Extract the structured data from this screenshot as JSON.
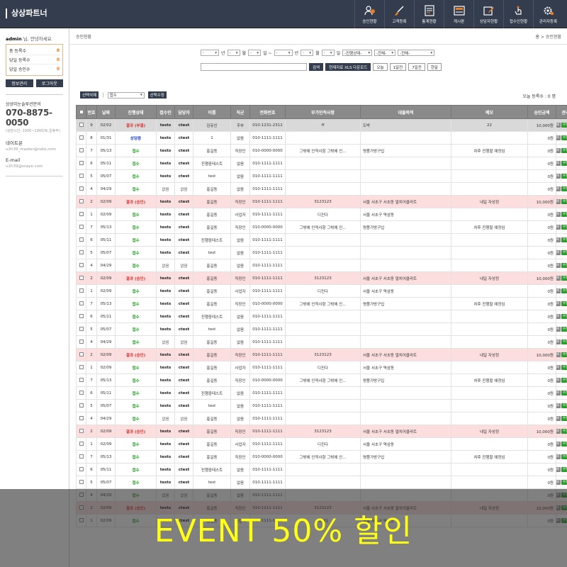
{
  "app": {
    "brand": "상상파트너"
  },
  "nav": [
    {
      "label": "승인현황",
      "icon": "users-icon"
    },
    {
      "label": "고객등록",
      "icon": "brush-icon"
    },
    {
      "label": "통계현황",
      "icon": "chart-board-icon"
    },
    {
      "label": "게시판",
      "icon": "board-icon"
    },
    {
      "label": "상담자현황",
      "icon": "edit-icon"
    },
    {
      "label": "접수인현황",
      "icon": "hand-click-icon"
    },
    {
      "label": "관리자등록",
      "icon": "gear-icon"
    }
  ],
  "sidebar": {
    "user": "admin",
    "greeting_suffix": " 님, 안녕하세요",
    "stats": [
      {
        "label": "총 등록수",
        "value": "8"
      },
      {
        "label": "당일 등록수",
        "value": "0"
      },
      {
        "label": "당일 승인수",
        "value": "0"
      }
    ],
    "btn_info": "정보관리",
    "btn_logout": "로그아웃",
    "cs_title": "상상미눈솔루션문의",
    "cs_phone": "070-8875-0050",
    "cs_hours": "(상담시간: 1000~1900/토,일휴무)",
    "nateon_label": "네이트온",
    "nateon_value": "u2h39_master@nate.com",
    "email_label": "E-mail",
    "email_value": "u2h39@ssaye.com"
  },
  "main": {
    "page_title": "승인현황",
    "breadcrumb": "홈 > 승인현황",
    "filters": {
      "sep_year": "년",
      "sep_month": "월",
      "sep_day": "일 ~",
      "sep_year2": "년",
      "sep_month2": "월",
      "sep_day2": "일",
      "sel_status": "-진행상태-",
      "sel_all1": "-전체-",
      "sel_all2": "-전체-"
    },
    "search_btn": "검색",
    "xls_btn": "현재자료 XLS 다운로드",
    "quick": [
      "오늘",
      "1일전",
      "7일전",
      "한달"
    ],
    "action_delete": "선택삭제",
    "action_select": "접수",
    "action_modify": "선택수정",
    "today_count": "오늘 등록수 : 0 명",
    "columns": [
      "번호",
      "날짜",
      "진행상태",
      "접수인",
      "담당자",
      "이름",
      "직군",
      "전화번호",
      "부가인적사항",
      "대출목적",
      "메모",
      "승인금액",
      "관리"
    ],
    "manage_labels": [
      "인쇄",
      "수정",
      "삭제"
    ],
    "rows": [
      [
        "9",
        "02/02",
        "결과 (부결)",
        "tests",
        "ctest",
        "김유신",
        "주부",
        "010-1231-2312",
        "ff",
        "도박",
        "22",
        "10,000원"
      ],
      [
        "8",
        "01/31",
        "상담중",
        "tests",
        "ctest",
        "1",
        "없음",
        "010-1111-1111",
        "",
        "",
        "",
        "0원"
      ],
      [
        "7",
        "05/13",
        "접수",
        "tests",
        "ctest",
        "홍길동",
        "직장인",
        "010-0000-0000",
        "그밖에 인적사항 그밖에 인...",
        "명품가방구입",
        "차후 진행할 예정임",
        "0원"
      ],
      [
        "6",
        "05/11",
        "접수",
        "tests",
        "ctest",
        "진행중테스트",
        "없음",
        "010-1111-1111",
        "",
        "",
        "",
        "0원"
      ],
      [
        "5",
        "05/07",
        "접수",
        "tests",
        "ctest",
        "test",
        "없음",
        "010-1111-1111",
        "",
        "",
        "",
        "0원"
      ],
      [
        "4",
        "04/29",
        "접수",
        "없음",
        "없음",
        "홍길동",
        "없음",
        "010-1111-1111",
        "",
        "",
        "",
        "0원"
      ],
      [
        "2",
        "02/09",
        "결과 (승인)",
        "tests",
        "ctest",
        "홍길동",
        "직장인",
        "010-1111-1111",
        "3123123",
        "서울 서초구 서초동 멀치어클라트",
        "내일 자성정",
        "10,000원"
      ],
      [
        "1",
        "02/09",
        "접수",
        "tests",
        "ctest",
        "홍길동",
        "사업자",
        "010-1111-1111",
        "디진다",
        "서울 서초구 역삼동",
        "",
        "0원"
      ],
      [
        "7",
        "05/13",
        "접수",
        "tests",
        "ctest",
        "홍길동",
        "직장인",
        "010-0000-0000",
        "그밖에 인적사항 그밖에 인...",
        "명품가방구입",
        "차후 진행할 예정임",
        "0원"
      ],
      [
        "6",
        "05/11",
        "접수",
        "tests",
        "ctest",
        "진행중테스트",
        "없음",
        "010-1111-1111",
        "",
        "",
        "",
        "0원"
      ],
      [
        "5",
        "05/07",
        "접수",
        "tests",
        "ctest",
        "test",
        "없음",
        "010-1111-1111",
        "",
        "",
        "",
        "0원"
      ],
      [
        "4",
        "04/29",
        "접수",
        "없음",
        "없음",
        "홍길동",
        "없음",
        "010-1111-1111",
        "",
        "",
        "",
        "0원"
      ],
      [
        "2",
        "02/09",
        "결과 (승인)",
        "tests",
        "ctest",
        "홍길동",
        "직장인",
        "010-1111-1111",
        "3123123",
        "서울 서초구 서초동 멀치어클라트",
        "내일 자성정",
        "10,000원"
      ],
      [
        "1",
        "02/09",
        "접수",
        "tests",
        "ctest",
        "홍길동",
        "사업자",
        "010-1111-1111",
        "디진다",
        "서울 서초구 역삼동",
        "",
        "0원"
      ],
      [
        "7",
        "05/13",
        "접수",
        "tests",
        "ctest",
        "홍길동",
        "직장인",
        "010-0000-0000",
        "그밖에 인적사항 그밖에 인...",
        "명품가방구입",
        "차후 진행할 예정임",
        "0원"
      ],
      [
        "6",
        "05/11",
        "접수",
        "tests",
        "ctest",
        "진행중테스트",
        "없음",
        "010-1111-1111",
        "",
        "",
        "",
        "0원"
      ],
      [
        "5",
        "05/07",
        "접수",
        "tests",
        "ctest",
        "test",
        "없음",
        "010-1111-1111",
        "",
        "",
        "",
        "0원"
      ],
      [
        "4",
        "04/29",
        "접수",
        "없음",
        "없음",
        "홍길동",
        "없음",
        "010-1111-1111",
        "",
        "",
        "",
        "0원"
      ],
      [
        "2",
        "02/09",
        "결과 (승인)",
        "tests",
        "ctest",
        "홍길동",
        "직장인",
        "010-1111-1111",
        "3123123",
        "서울 서초구 서초동 멀치어클라트",
        "내일 자성정",
        "10,000원"
      ],
      [
        "1",
        "02/09",
        "접수",
        "tests",
        "ctest",
        "홍길동",
        "사업자",
        "010-1111-1111",
        "디진다",
        "서울 서초구 역삼동",
        "",
        "0원"
      ],
      [
        "7",
        "05/13",
        "접수",
        "tests",
        "ctest",
        "홍길동",
        "직장인",
        "010-0000-0000",
        "그밖에 인적사항 그밖에 인...",
        "명품가방구입",
        "차후 진행할 예정임",
        "0원"
      ],
      [
        "6",
        "05/11",
        "접수",
        "tests",
        "ctest",
        "진행중테스트",
        "없음",
        "010-1111-1111",
        "",
        "",
        "",
        "0원"
      ],
      [
        "5",
        "05/07",
        "접수",
        "tests",
        "ctest",
        "test",
        "없음",
        "010-1111-1111",
        "",
        "",
        "",
        "0원"
      ],
      [
        "4",
        "04/29",
        "접수",
        "없음",
        "없음",
        "홍길동",
        "없음",
        "010-1111-1111",
        "",
        "",
        "",
        "0원"
      ],
      [
        "2",
        "02/09",
        "결과 (승인)",
        "tests",
        "ctest",
        "홍길동",
        "직장인",
        "010-1111-1111",
        "3123123",
        "서울 서초구 서초동 멀치어클라트",
        "내일 자성정",
        "10,000원"
      ],
      [
        "1",
        "02/09",
        "접수",
        "tests",
        "ctest",
        "홍길동",
        "사업자",
        "010-1111-1111",
        "디진다",
        "서울 서초구 역삼동",
        "",
        "0원"
      ],
      [
        "7",
        "05/13",
        "접수",
        "tests",
        "ctest",
        "홍길동",
        "직장인",
        "010-0000-0000",
        "그밖에 인적사항 그밖에 인...",
        "명품가방구입",
        "차후 진행할 예정임",
        "0원"
      ],
      [
        "6",
        "05/11",
        "접수",
        "tests",
        "ctest",
        "진행중테스트",
        "없음",
        "010-1111-1111",
        "",
        "",
        "",
        "0원"
      ],
      [
        "5",
        "05/07",
        "접수",
        "tests",
        "ctest",
        "test",
        "없음",
        "010-1111-1111",
        "",
        "",
        "",
        "0원"
      ],
      [
        "4",
        "04/29",
        "접수",
        "없음",
        "없음",
        "홍길동",
        "없음",
        "010-1111-1111",
        "",
        "",
        "",
        "0원"
      ],
      [
        "2",
        "02/09",
        "결과 (승인)",
        "tests",
        "ctest",
        "홍길동",
        "직장인",
        "010-1111-1111",
        "3123123",
        "서울 서초구 서초동 멀치어클라트",
        "내일 자성정",
        "10,000원"
      ],
      [
        "1",
        "02/09",
        "접수",
        "tests",
        "ctest",
        "홍길동",
        "사업자",
        "010-1111-1111",
        "디진다",
        "서울 서초구 역삼동",
        "",
        "0원"
      ]
    ]
  },
  "banner": {
    "text": "EVENT 50% 할인"
  },
  "colors": {
    "nav_bg": "#343d4e",
    "ok": "#1a9a1a",
    "rejected": "#d83030",
    "consult": "#1f3fd0",
    "highlight_row": "#fcdede",
    "banner_text": "#ffff14"
  }
}
